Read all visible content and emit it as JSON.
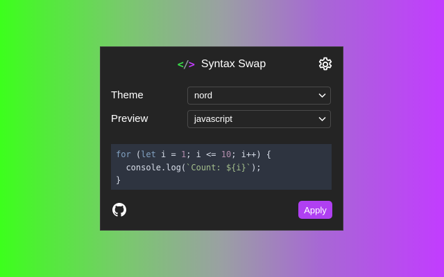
{
  "app": {
    "logo_text": "</>",
    "title": "Syntax Swap"
  },
  "icons": {
    "settings": "gear-icon",
    "github": "github-icon",
    "dropdown": "chevron-down-icon"
  },
  "colors": {
    "background_left": "#3cff1c",
    "background_right": "#c23cff",
    "panel": "#242424",
    "accent": "#b040f2",
    "code_background": "#2e3440",
    "logo_left": "#39e04a",
    "logo_right": "#c23cff"
  },
  "settings": {
    "theme": {
      "label": "Theme",
      "value": "nord"
    },
    "preview": {
      "label": "Preview",
      "value": "javascript"
    }
  },
  "code": {
    "lines": [
      "for (let i = 1; i <= 10; i++) {",
      "  console.log(`Count: ${i}`);",
      "}"
    ],
    "tokens": {
      "for": "for",
      "let": "let",
      "num1": "1",
      "num10": "10",
      "string": "`Count: ${i}`"
    }
  },
  "footer": {
    "apply_label": "Apply"
  }
}
